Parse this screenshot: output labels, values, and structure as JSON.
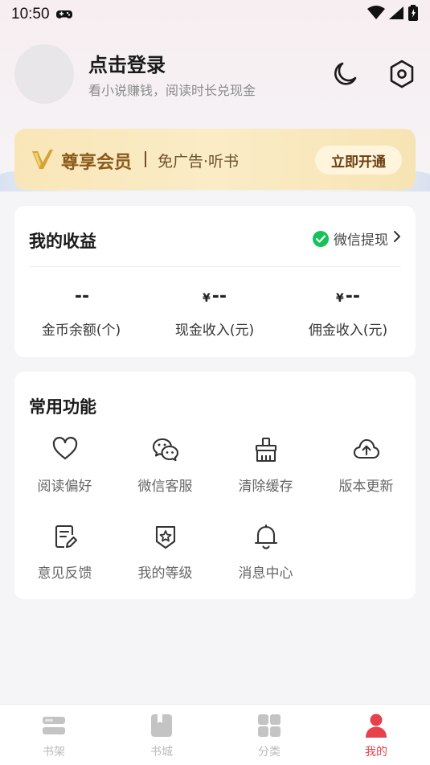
{
  "status_bar": {
    "time": "10:50"
  },
  "profile": {
    "title": "点击登录",
    "subtitle": "看小说赚钱，阅读时长兑现金"
  },
  "vip": {
    "title": "尊享会员",
    "desc": "免广告·听书",
    "button": "立即开通"
  },
  "earnings": {
    "title": "我的收益",
    "withdraw_label": "微信提现",
    "stats": [
      {
        "currency": "",
        "value": "--",
        "label": "金币余额(个)"
      },
      {
        "currency": "¥",
        "value": "--",
        "label": "现金收入(元)"
      },
      {
        "currency": "¥",
        "value": "--",
        "label": "佣金收入(元)"
      }
    ]
  },
  "functions": {
    "title": "常用功能",
    "items": [
      {
        "label": "阅读偏好",
        "icon": "heart-icon"
      },
      {
        "label": "微信客服",
        "icon": "wechat-chat-icon"
      },
      {
        "label": "清除缓存",
        "icon": "broom-icon"
      },
      {
        "label": "版本更新",
        "icon": "cloud-upload-icon"
      },
      {
        "label": "意见反馈",
        "icon": "feedback-edit-icon"
      },
      {
        "label": "我的等级",
        "icon": "star-badge-icon"
      },
      {
        "label": "消息中心",
        "icon": "bell-icon"
      }
    ]
  },
  "tabbar": {
    "tabs": [
      {
        "label": "书架",
        "icon": "bookshelf-icon",
        "active": false
      },
      {
        "label": "书城",
        "icon": "book-store-icon",
        "active": false
      },
      {
        "label": "分类",
        "icon": "category-grid-icon",
        "active": false
      },
      {
        "label": "我的",
        "icon": "profile-icon",
        "active": true
      }
    ]
  },
  "colors": {
    "accent": "#e8414b",
    "vip_gold": "#8b5a1c",
    "wechat_green": "#18c25a"
  }
}
